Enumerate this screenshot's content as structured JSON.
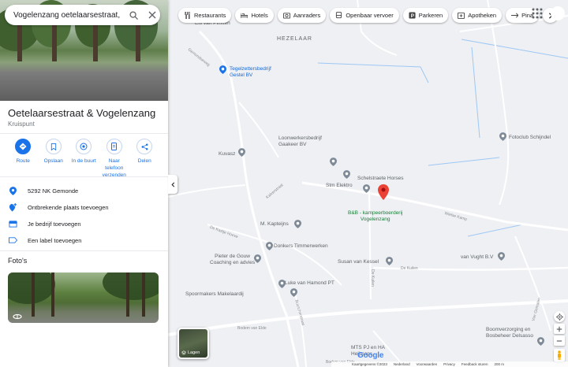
{
  "search": {
    "value": "Vogelenzang oetelaarsestraat, Gemo"
  },
  "place": {
    "title": "Oetelaarsestraat & Vogelenzang",
    "type": "Kruispunt"
  },
  "actions": [
    {
      "label": "Route",
      "icon": "directions-icon"
    },
    {
      "label": "Opslaan",
      "icon": "bookmark-icon"
    },
    {
      "label": "In de buurt",
      "icon": "nearby-icon"
    },
    {
      "label": "Naar telefoon verzenden",
      "icon": "send-to-phone-icon"
    },
    {
      "label": "Delen",
      "icon": "share-icon"
    }
  ],
  "info": {
    "address": "5292 NK Gemonde",
    "add_place": "Ontbrekende plaats toevoegen",
    "add_business": "Je bedrijf toevoegen",
    "add_label": "Een label toevoegen"
  },
  "photos": {
    "heading": "Foto's"
  },
  "chips": [
    {
      "label": "Restaurants",
      "icon": "fork-knife-icon"
    },
    {
      "label": "Hotels",
      "icon": "bed-icon"
    },
    {
      "label": "Aanraders",
      "icon": "camera-icon"
    },
    {
      "label": "Openbaar vervoer",
      "icon": "transit-icon"
    },
    {
      "label": "Parkeren",
      "icon": "parking-icon"
    },
    {
      "label": "Apotheken",
      "icon": "pharmacy-icon"
    },
    {
      "label": "Pina",
      "icon": "atm-icon"
    }
  ],
  "map": {
    "region": "HEZELAAR",
    "places": [
      {
        "name": "Els van Pinxten",
        "kind": "gray"
      },
      {
        "name": "Tegelzettersbedrijf\nGestel BV",
        "kind": "blue"
      },
      {
        "name": "Kuvasz",
        "kind": "gray"
      },
      {
        "name": "Loonwerkersbedrijf\nGaakeer BV",
        "kind": "gray"
      },
      {
        "name": "Schelstraete Horses",
        "kind": "gray"
      },
      {
        "name": "Stm Elektro",
        "kind": "gray"
      },
      {
        "name": "B&B - kampeerboerderij\nVogelenzang",
        "kind": "green"
      },
      {
        "name": "M. Kapteijns",
        "kind": "gray"
      },
      {
        "name": "Donkers Timmerwerken",
        "kind": "gray"
      },
      {
        "name": "Pieter de Gouw\nCoaching en advies",
        "kind": "gray"
      },
      {
        "name": "Susan van Kessel",
        "kind": "gray"
      },
      {
        "name": "van Vught B.V",
        "kind": "gray"
      },
      {
        "name": "Luke van Hamond PT",
        "kind": "gray"
      },
      {
        "name": "Spoormakers Makelaardij",
        "kind": "gray"
      },
      {
        "name": "Fotoclub Schijndel",
        "kind": "gray"
      },
      {
        "name": "Boomverzorging en\nBosbeheer Delsasso",
        "kind": "gray"
      },
      {
        "name": "MTS PJ en HA\nHeijmans",
        "kind": "gray"
      }
    ],
    "roads": [
      "Gemondseweg",
      "Wielse Kamp",
      "De Kuilen",
      "De Kuilen",
      "Bodem van Elde",
      "Bodem van Elde",
      "Kalverstraat",
      "De Kastje Hoeve",
      "Busscherstraat",
      "Vier Gemalen"
    ],
    "layers_label": "Lagen",
    "logo": "Google",
    "attribution": [
      "Kaartgegevens ©2023",
      "Nederland",
      "Voorwaarden",
      "Privacy",
      "Feedback sturen",
      "200 m"
    ]
  },
  "colors": {
    "accent": "#1a73e8",
    "pin_red": "#ea4335",
    "place_gray": "#7e8a97",
    "place_green": "#188038",
    "place_blue": "#1a73e8"
  }
}
